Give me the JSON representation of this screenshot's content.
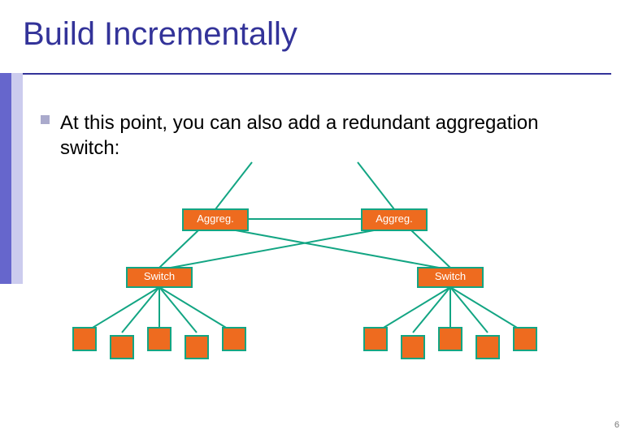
{
  "slide": {
    "title": "Build Incrementally",
    "bullet": "At this point, you can also add a redundant aggregation switch:",
    "page_number": "6"
  },
  "diagram": {
    "aggreg": {
      "left_label": "Aggreg.",
      "right_label": "Aggreg."
    },
    "switch": {
      "left_label": "Switch",
      "right_label": "Switch"
    },
    "colors": {
      "box_fill": "#ee6b1f",
      "box_stroke": "#13a583",
      "line": "#13a583"
    }
  }
}
